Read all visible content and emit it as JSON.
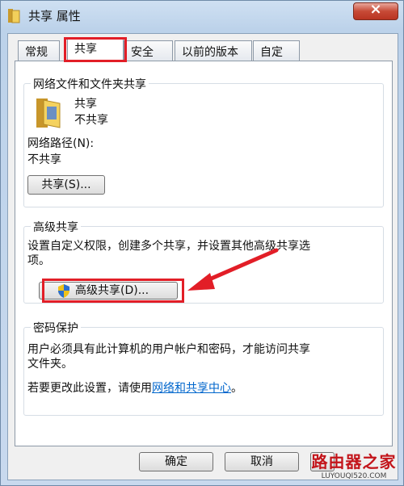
{
  "window": {
    "title": "共享 属性",
    "close_symbol": "×"
  },
  "tabs": [
    {
      "label": "常规"
    },
    {
      "label": "共享",
      "active": true
    },
    {
      "label": "安全"
    },
    {
      "label": "以前的版本"
    },
    {
      "label": "自定义"
    }
  ],
  "network_sharing": {
    "group_title": "网络文件和文件夹共享",
    "folder_name": "共享",
    "status": "不共享",
    "path_label": "网络路径(N):",
    "path_value": "不共享",
    "share_button": "共享(S)..."
  },
  "advanced_sharing": {
    "group_title": "高级共享",
    "description_line1": "设置自定义权限，创建多个共享，并设置其他高级共享选",
    "description_line2": "项。",
    "button": "高级共享(D)..."
  },
  "password_protection": {
    "group_title": "密码保护",
    "description_line1": "用户必须具有此计算机的用户帐户和密码，才能访问共享",
    "description_line2": "文件夹。",
    "change_prefix": "若要更改此设置，请使用",
    "change_link": "网络和共享中心",
    "change_suffix": "。"
  },
  "footer": {
    "ok_button": "确定",
    "cancel_button": "取消"
  },
  "watermark": {
    "text": "路由器之家",
    "url": "LUYOUQI520.COM"
  },
  "colors": {
    "highlight": "#e21e27",
    "link": "#0066cc",
    "watermark": "#c3151b"
  }
}
